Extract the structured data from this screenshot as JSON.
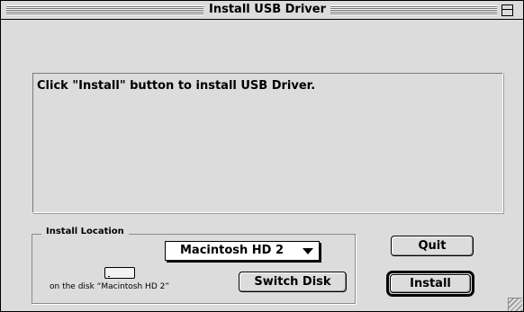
{
  "window": {
    "title": "Install USB Driver"
  },
  "message": {
    "text": "Click \"Install\" button to install USB Driver."
  },
  "install_location": {
    "label": "Install Location",
    "selected_disk": "Macintosh HD 2",
    "disk_caption": "on the disk “Macintosh HD 2”",
    "switch_disk_label": "Switch Disk"
  },
  "actions": {
    "quit_label": "Quit",
    "install_label": "Install"
  },
  "icons": {
    "collapse": "collapse-box-icon",
    "popup_arrow": "triangle-down-icon",
    "disk": "hard-disk-icon",
    "grow": "resize-grip-icon"
  }
}
